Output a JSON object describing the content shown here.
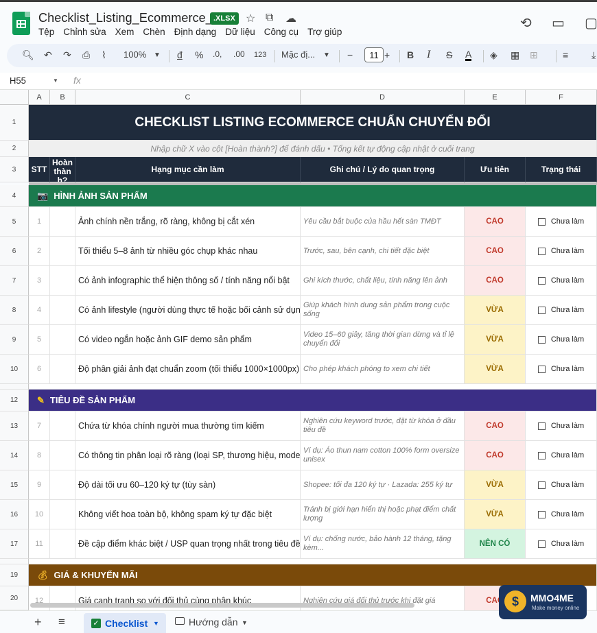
{
  "app": {
    "doc_title": "Checklist_Listing_Ecommerce_VI",
    "file_badge": ".XLSX",
    "menu": [
      "Tệp",
      "Chỉnh sửa",
      "Xem",
      "Chèn",
      "Định dạng",
      "Dữ liệu",
      "Công cụ",
      "Trợ giúp"
    ]
  },
  "toolbar": {
    "zoom": "100%",
    "currency": "đ",
    "percent": "%",
    "dec_decrease": ".0,",
    "dec_increase": ".00",
    "number_format": "123",
    "font": "Mặc đị...",
    "font_size": "11",
    "bold": "B",
    "italic": "I",
    "strike": "S",
    "text_color": "A"
  },
  "formula": {
    "cell_ref": "H55",
    "fx": "fx"
  },
  "columns": [
    "A",
    "B",
    "C",
    "D",
    "E",
    "F"
  ],
  "sheet": {
    "title": "CHECKLIST LISTING ECOMMERCE CHUẨN CHUYỂN ĐỔI",
    "subtitle": "Nhập chữ X vào cột [Hoàn thành?] để đánh dấu • Tổng kết tự động cập nhật ở cuối trang",
    "headers": {
      "stt": "STT",
      "done": "Hoàn thàn h?",
      "task": "Hạng mục cần làm",
      "note": "Ghi chú / Lý do quan trọng",
      "priority": "Ưu tiên",
      "status": "Trạng thái"
    },
    "sections": [
      {
        "label": "HÌNH ẢNH SẢN PHẨM",
        "icon": "camera-icon",
        "color": "#1b7a4e",
        "row": "4"
      },
      {
        "label": "TIÊU ĐỀ SẢN PHẨM",
        "icon": "pencil-icon",
        "color": "#3b2e86",
        "row": "12"
      },
      {
        "label": "GIÁ & KHUYẾN MÃI",
        "icon": "money-bag-icon",
        "color": "#7a4a0a",
        "row": "19"
      }
    ],
    "items": [
      {
        "row": "5",
        "stt": "1",
        "task": "Ảnh chính nền trắng, rõ ràng, không bị cắt xén",
        "note": "Yêu cầu bắt buộc của hầu hết sàn TMĐT",
        "priority": "CAO",
        "status": "Chưa làm"
      },
      {
        "row": "6",
        "stt": "2",
        "task": "Tối thiểu 5–8 ảnh từ nhiều góc chụp khác nhau",
        "note": "Trước, sau, bên cạnh, chi tiết đặc biệt",
        "priority": "CAO",
        "status": "Chưa làm"
      },
      {
        "row": "7",
        "stt": "3",
        "task": "Có ảnh infographic thể hiện thông số / tính năng nổi bật",
        "note": "Ghi kích thước, chất liệu, tính năng lên ảnh",
        "priority": "CAO",
        "status": "Chưa làm"
      },
      {
        "row": "8",
        "stt": "4",
        "task": "Có ảnh lifestyle (người dùng thực tế hoặc bối cảnh sử dụng)",
        "note": "Giúp khách hình dung sản phẩm trong cuộc sống",
        "priority": "VỪA",
        "status": "Chưa làm"
      },
      {
        "row": "9",
        "stt": "5",
        "task": "Có video ngắn hoặc ảnh GIF demo sản phẩm",
        "note": "Video 15–60 giây, tăng thời gian dừng và tỉ lệ chuyển đổi",
        "priority": "VỪA",
        "status": "Chưa làm"
      },
      {
        "row": "10",
        "stt": "6",
        "task": "Độ phân giải ảnh đạt chuẩn zoom (tối thiểu 1000×1000px)",
        "note": "Cho phép khách phóng to xem chi tiết",
        "priority": "VỪA",
        "status": "Chưa làm"
      },
      {
        "row": "13",
        "stt": "7",
        "task": "Chứa từ khóa chính người mua thường tìm kiếm",
        "note": "Nghiên cứu keyword trước, đặt từ khóa ở đầu tiêu đề",
        "priority": "CAO",
        "status": "Chưa làm"
      },
      {
        "row": "14",
        "stt": "8",
        "task": "Có thông tin phân loại rõ ràng (loại SP, thương hiệu, model)",
        "note": "Ví dụ: Áo thun nam cotton 100% form oversize unisex",
        "priority": "CAO",
        "status": "Chưa làm"
      },
      {
        "row": "15",
        "stt": "9",
        "task": "Độ dài tối ưu 60–120 ký tự (tùy sàn)",
        "note": "Shopee: tối đa 120 ký tự · Lazada: 255 ký tự",
        "priority": "VỪA",
        "status": "Chưa làm"
      },
      {
        "row": "16",
        "stt": "10",
        "task": "Không viết hoa toàn bộ, không spam ký tự đặc biệt",
        "note": "Tránh bị giới hạn hiển thị hoặc phạt điểm chất lượng",
        "priority": "VỪA",
        "status": "Chưa làm"
      },
      {
        "row": "17",
        "stt": "11",
        "task": "Đề cập điểm khác biệt / USP quan trọng nhất trong tiêu đề",
        "note": "Ví dụ: chống nước, bảo hành 12 tháng, tặng kèm...",
        "priority": "NÊN CÓ",
        "status": "Chưa làm"
      },
      {
        "row": "20",
        "stt": "12",
        "task": "Giá cạnh tranh so với đối thủ cùng phân khúc",
        "note": "Nghiên cứu giá đối thủ trước khi đặt giá",
        "priority": "CAO",
        "status": ""
      }
    ],
    "other_rows": [
      "1",
      "2",
      "3",
      "11",
      "18"
    ]
  },
  "tabs": {
    "active": "Checklist",
    "other": "Hướng dẫn"
  },
  "watermark": {
    "name": "MMO4ME",
    "tagline": "Make money online"
  },
  "colors": {
    "header_bg": "#1f2b3c",
    "cao_bg": "#fce8e8",
    "vua_bg": "#fdf3c7",
    "nen_bg": "#d4f4e0"
  }
}
